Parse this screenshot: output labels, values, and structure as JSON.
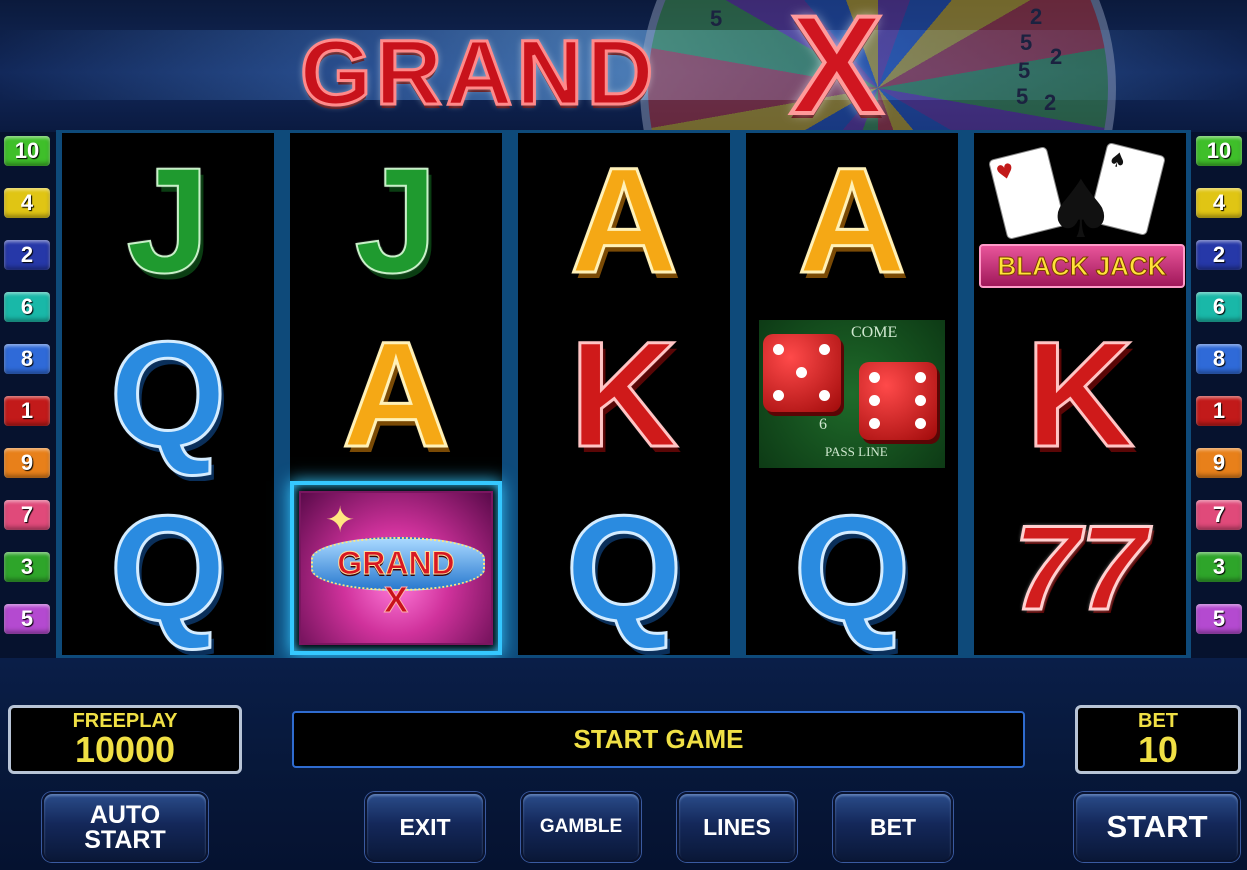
{
  "header": {
    "logo_text": "GRAND",
    "logo_x": "X",
    "wheel_numbers": [
      "5",
      "2",
      "5",
      "5",
      "2",
      "5",
      "2"
    ]
  },
  "lines_left": [
    {
      "label": "10",
      "color": "#3fbf2a"
    },
    {
      "label": "4",
      "color": "#e0c514"
    },
    {
      "label": "2",
      "color": "#2638a8"
    },
    {
      "label": "6",
      "color": "#19b8a8"
    },
    {
      "label": "8",
      "color": "#2f6ad8"
    },
    {
      "label": "1",
      "color": "#c21a1a"
    },
    {
      "label": "9",
      "color": "#e8801a"
    },
    {
      "label": "7",
      "color": "#e04a7a"
    },
    {
      "label": "3",
      "color": "#2ea52a"
    },
    {
      "label": "5",
      "color": "#b44ad0"
    }
  ],
  "lines_right": [
    {
      "label": "10",
      "color": "#3fbf2a"
    },
    {
      "label": "4",
      "color": "#e0c514"
    },
    {
      "label": "2",
      "color": "#2638a8"
    },
    {
      "label": "6",
      "color": "#19b8a8"
    },
    {
      "label": "8",
      "color": "#2f6ad8"
    },
    {
      "label": "1",
      "color": "#c21a1a"
    },
    {
      "label": "9",
      "color": "#e8801a"
    },
    {
      "label": "7",
      "color": "#e04a7a"
    },
    {
      "label": "3",
      "color": "#2ea52a"
    },
    {
      "label": "5",
      "color": "#b44ad0"
    }
  ],
  "reels": [
    [
      "J",
      "Q",
      "Q"
    ],
    [
      "J",
      "A",
      "GRANDX"
    ],
    [
      "A",
      "K",
      "Q"
    ],
    [
      "A",
      "DICE",
      "Q"
    ],
    [
      "BLACKJACK",
      "K",
      "SEVENS"
    ]
  ],
  "symbols": {
    "grandx_text": "GRAND",
    "grandx_x": "X",
    "blackjack_text": "BLACK JACK",
    "dice_come": "COME",
    "dice_pass_line": "PASS LINE",
    "dice_six": "6",
    "sevens_text": "77"
  },
  "freeplay": {
    "label": "FREEPLAY",
    "value": "10000"
  },
  "message": "START GAME",
  "bet_display": {
    "label": "BET",
    "value": "10"
  },
  "buttons": {
    "auto_start_line1": "AUTO",
    "auto_start_line2": "START",
    "exit": "EXIT",
    "gamble": "GAMBLE",
    "lines": "LINES",
    "bet": "BET",
    "start": "START"
  }
}
